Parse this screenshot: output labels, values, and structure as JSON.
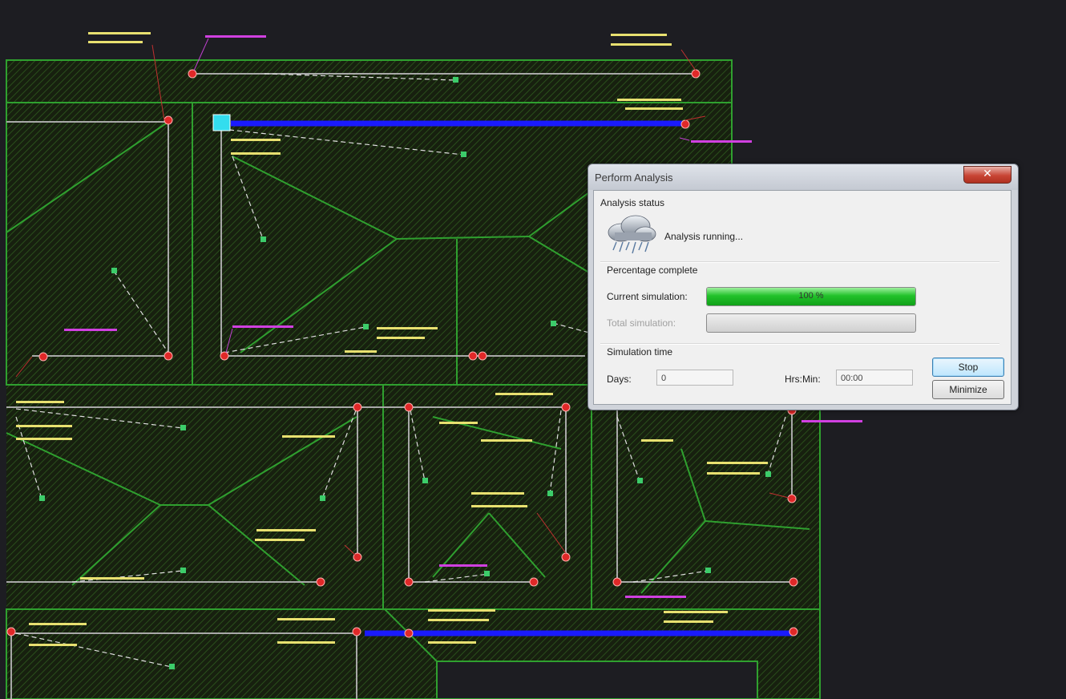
{
  "dialog": {
    "title": "Perform Analysis",
    "close_glyph": "✕",
    "analysis_status_heading": "Analysis status",
    "status_icon": "rain-cloud-icon",
    "status_text": "Analysis running...",
    "percentage_heading": "Percentage complete",
    "current_simulation_label": "Current simulation:",
    "current_simulation_text": "100 %",
    "current_simulation_progress": 1.0,
    "total_simulation_label": "Total simulation:",
    "total_simulation_progress": 0.0,
    "simulation_time_heading": "Simulation time",
    "days_label": "Days:",
    "days_value": "0",
    "hrs_min_label": "Hrs:Min:",
    "hrs_min_value": "00:00",
    "stop_button": "Stop",
    "minimize_button": "Minimize"
  },
  "colors": {
    "canvas_background": "#1d1d22",
    "pipe_highlight": "#1a1aff",
    "node": "#e02828",
    "annotation_yellow": "#e8e070",
    "annotation_magenta": "#d040e0",
    "catchment_green": "#2fa02f",
    "progress_fill": "#22c22a"
  }
}
